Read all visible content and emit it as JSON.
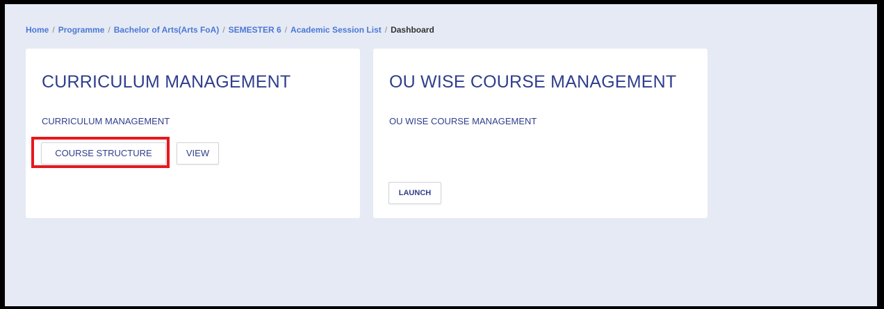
{
  "breadcrumb": {
    "items": [
      "Home",
      "Programme",
      "Bachelor of Arts(Arts FoA)",
      "SEMESTER 6",
      "Academic Session List"
    ],
    "current": "Dashboard",
    "separator": "/"
  },
  "cards": [
    {
      "title": "CURRICULUM MANAGEMENT",
      "subtitle": "CURRICULUM MANAGEMENT",
      "buttons": [
        "COURSE STRUCTURE",
        "VIEW"
      ]
    },
    {
      "title": "OU WISE COURSE MANAGEMENT",
      "subtitle": "OU WISE COURSE MANAGEMENT",
      "buttons": [
        "LAUNCH"
      ]
    }
  ],
  "colors": {
    "background": "#e6eaf5",
    "accent": "#2f3e8c",
    "link": "#4a78d4",
    "highlight": "#e8161d"
  }
}
